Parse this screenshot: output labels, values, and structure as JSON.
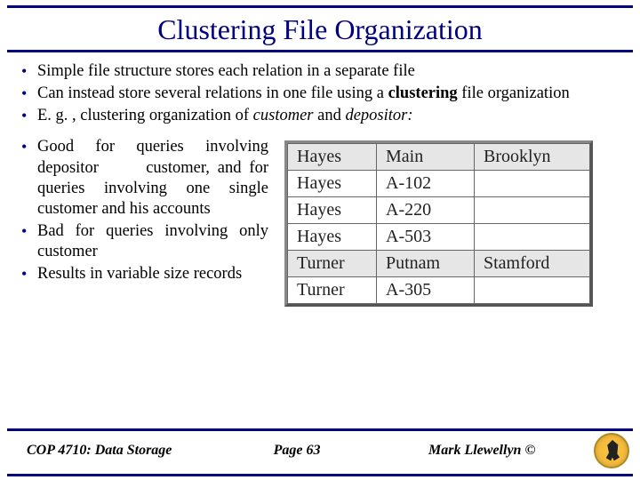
{
  "title": "Clustering File Organization",
  "bullets_top": {
    "b1": "Simple file structure stores each relation in a separate file",
    "b2_pre": "Can instead store several relations in one file using a ",
    "b2_bold": "clustering",
    "b2_post": " file organization",
    "b3_pre": "E. g. , clustering organization of ",
    "b3_it1": "customer",
    "b3_mid": " and ",
    "b3_it2": "depositor:",
    "b3_post": ""
  },
  "bullets_side": {
    "s1": "Good for queries involving depositor      customer, and for queries involving one single customer and his accounts",
    "s2": "Bad for queries involving only customer",
    "s3": "Results in variable size records"
  },
  "table": {
    "rows": [
      {
        "cls": "cust",
        "c1": "Hayes",
        "c2": "Main",
        "c3": "Brooklyn"
      },
      {
        "cls": "dep",
        "c1": "Hayes",
        "c2": "A-102",
        "c3": ""
      },
      {
        "cls": "dep",
        "c1": "Hayes",
        "c2": "A-220",
        "c3": ""
      },
      {
        "cls": "dep",
        "c1": "Hayes",
        "c2": "A-503",
        "c3": ""
      },
      {
        "cls": "cust",
        "c1": "Turner",
        "c2": "Putnam",
        "c3": "Stamford"
      },
      {
        "cls": "dep",
        "c1": "Turner",
        "c2": "A-305",
        "c3": ""
      }
    ]
  },
  "footer": {
    "left": "COP 4710: Data Storage",
    "center": "Page 63",
    "right": "Mark Llewellyn ©"
  }
}
